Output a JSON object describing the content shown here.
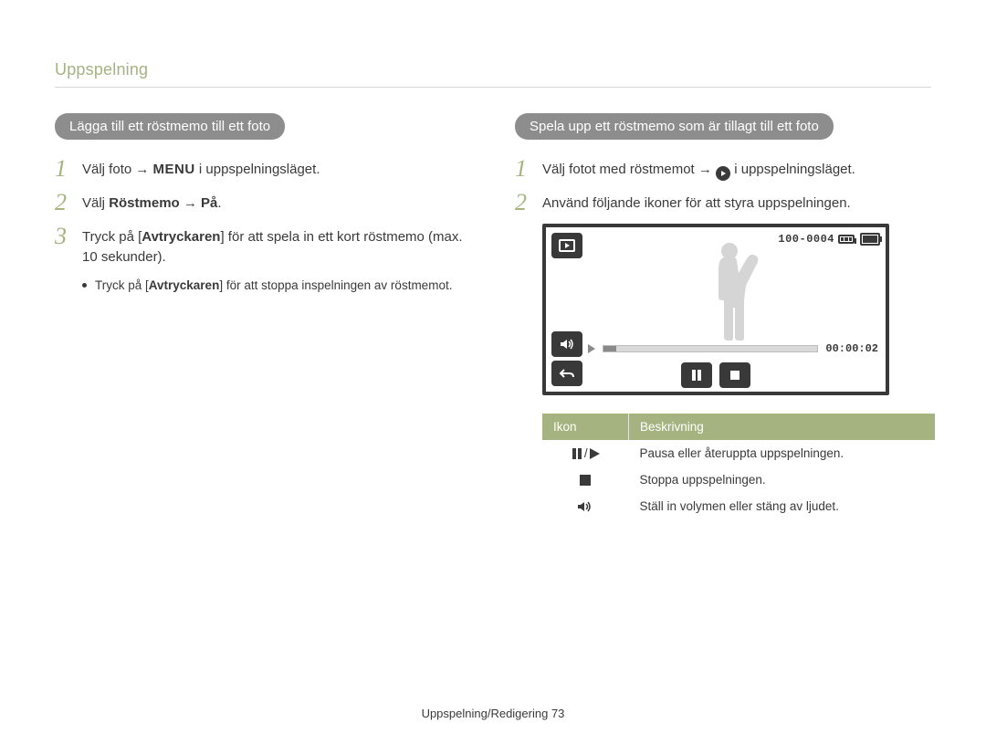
{
  "section_title": "Uppspelning",
  "left": {
    "heading": "Lägga till ett röstmemo till ett foto",
    "step1_pre": "Välj foto ",
    "arrow": "→",
    "menu_label": "MENU",
    "step1_post": " i uppspelningsläget.",
    "step2_pre": "Välj ",
    "step2_bold": "Röstmemo",
    "step2_arrow": " → ",
    "step2_on": "På",
    "step2_end": ".",
    "step3_pre": "Tryck på [",
    "step3_btn": "Avtryckaren",
    "step3_post": "] för att spela in ett kort röstmemo (max. 10 sekunder).",
    "bullet_pre": "Tryck på [",
    "bullet_btn": "Avtryckaren",
    "bullet_post": "] för att stoppa inspelningen av röstmemot."
  },
  "right": {
    "heading": "Spela upp ett röstmemo som är tillagt till ett foto",
    "step1_pre": "Välj fotot med röstmemot ",
    "step1_arrow": "→ ",
    "step1_post": " i uppspelningsläget.",
    "step2": "Använd följande ikoner för att styra uppspelningen."
  },
  "lcd": {
    "file_counter": "100-0004",
    "time": "00:00:02"
  },
  "table": {
    "head_icon": "Ikon",
    "head_desc": "Beskrivning",
    "rows": [
      {
        "desc": "Pausa eller återuppta uppspelningen."
      },
      {
        "desc": "Stoppa uppspelningen."
      },
      {
        "desc": "Ställ in volymen eller stäng av ljudet."
      }
    ]
  },
  "footer": {
    "text": "Uppspelning/Redigering",
    "page": "73"
  }
}
